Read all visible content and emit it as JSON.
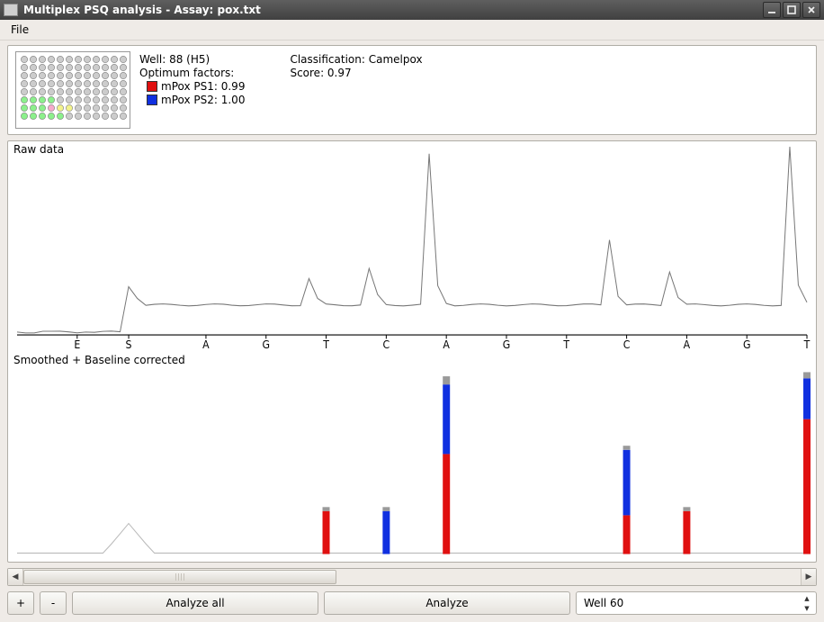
{
  "window": {
    "title": "Multiplex PSQ analysis - Assay: pox.txt"
  },
  "menu": {
    "file": "File"
  },
  "info": {
    "well_label": "Well: 88 (H5)",
    "optimum_label": "Optimum factors:",
    "factors": [
      {
        "name": "mPox PS1: 0.99",
        "color": "red"
      },
      {
        "name": "mPox PS2: 1.00",
        "color": "blue"
      }
    ],
    "classification_label": "Classification: Camelpox",
    "score_label": "Score: 0.97"
  },
  "plate": {
    "rows": 8,
    "cols": 12,
    "circles": {
      "row0": [
        "g",
        "g",
        "g",
        "g",
        "g",
        "g",
        "g",
        "g",
        "g",
        "g",
        "g",
        "g"
      ],
      "row1": [
        "g",
        "g",
        "g",
        "g",
        "g",
        "g",
        "g",
        "g",
        "g",
        "g",
        "g",
        "g"
      ],
      "row2": [
        "g",
        "g",
        "g",
        "g",
        "g",
        "g",
        "g",
        "g",
        "g",
        "g",
        "g",
        "g"
      ],
      "row3": [
        "g",
        "g",
        "g",
        "g",
        "g",
        "g",
        "g",
        "g",
        "g",
        "g",
        "g",
        "g"
      ],
      "row4": [
        "g",
        "g",
        "g",
        "g",
        "g",
        "g",
        "g",
        "g",
        "g",
        "g",
        "g",
        "g"
      ],
      "row5": [
        "lg",
        "lg",
        "lg",
        "lg",
        "g",
        "g",
        "g",
        "g",
        "g",
        "g",
        "g",
        "g"
      ],
      "row6": [
        "lg",
        "lg",
        "lg",
        "p",
        "y",
        "y",
        "g",
        "g",
        "g",
        "g",
        "g",
        "g"
      ],
      "row7": [
        "lg",
        "lg",
        "lg",
        "lg",
        "lg",
        "g",
        "g",
        "g",
        "g",
        "g",
        "g",
        "g"
      ]
    }
  },
  "chart_data": [
    {
      "type": "line",
      "title": "Raw data",
      "xlabels": [
        "E",
        "S",
        "A",
        "G",
        "T",
        "C",
        "A",
        "G",
        "T",
        "C",
        "A",
        "G",
        "T"
      ],
      "ylim": [
        0,
        200
      ],
      "values": [
        3,
        3,
        3,
        4,
        3,
        3,
        3,
        3,
        4,
        3,
        3,
        3,
        3,
        52,
        40,
        32,
        32,
        32,
        32,
        32,
        32,
        32,
        32,
        32,
        32,
        32,
        32,
        32,
        32,
        32,
        32,
        32,
        32,
        32,
        60,
        38,
        32,
        32,
        32,
        32,
        32,
        70,
        42,
        32,
        32,
        32,
        32,
        32,
        192,
        52,
        34,
        32,
        32,
        32,
        32,
        32,
        32,
        32,
        32,
        32,
        32,
        32,
        32,
        32,
        32,
        32,
        32,
        32,
        32,
        102,
        42,
        32,
        32,
        32,
        32,
        32,
        68,
        40,
        32,
        32,
        32,
        32,
        32,
        32,
        32,
        32,
        32,
        32,
        32,
        32,
        200,
        52,
        34
      ],
      "xtick_positions": [
        7,
        13,
        22,
        29,
        36,
        43,
        50,
        57,
        64,
        71,
        78,
        85,
        92
      ]
    },
    {
      "type": "bar",
      "title": "Smoothed + Baseline corrected",
      "xlabels": [
        "E",
        "S",
        "A",
        "G",
        "T",
        "C",
        "A",
        "G",
        "T",
        "C",
        "A",
        "G",
        "T"
      ],
      "categories_x": [
        7,
        13,
        22,
        29,
        36,
        43,
        50,
        57,
        64,
        71,
        78,
        85,
        92
      ],
      "ylim": [
        0,
        180
      ],
      "series": [
        {
          "name": "PS1",
          "color": "#e01010",
          "values": [
            0,
            0,
            0,
            0,
            42,
            0,
            98,
            0,
            0,
            38,
            42,
            0,
            132
          ]
        },
        {
          "name": "PS2",
          "color": "#1030e0",
          "values": [
            0,
            0,
            0,
            0,
            0,
            42,
            68,
            0,
            0,
            64,
            0,
            0,
            40
          ]
        },
        {
          "name": "top",
          "color": "#9a9a9a",
          "values": [
            0,
            0,
            0,
            0,
            4,
            4,
            8,
            0,
            0,
            4,
            4,
            0,
            6
          ]
        }
      ],
      "ghost_peak_x": 13,
      "ghost_peak_h": 30
    }
  ],
  "toolbar": {
    "plus": "+",
    "minus": "-",
    "analyze_all": "Analyze all",
    "analyze": "Analyze",
    "well_selector": "Well 60"
  },
  "colors": {
    "red": "#e01010",
    "blue": "#1030e0",
    "grey": "#9a9a9a"
  }
}
